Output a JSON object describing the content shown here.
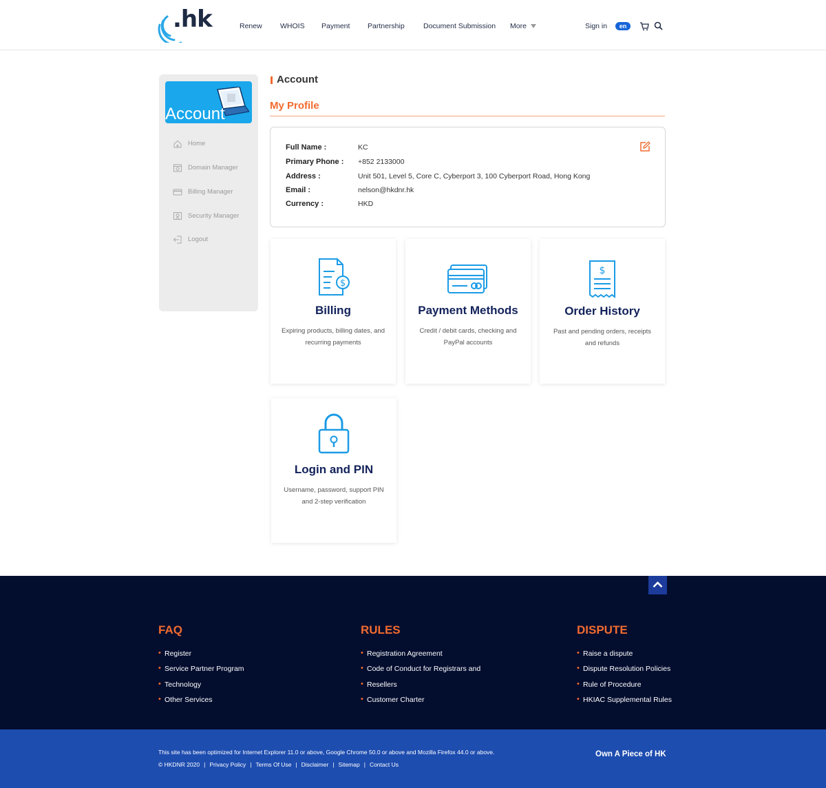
{
  "header": {
    "logo_text": ".hk",
    "nav": [
      "Renew",
      "WHOIS",
      "Payment",
      "Partnership",
      "Document Submission",
      "More"
    ],
    "signin": "Sign in",
    "lang": "en"
  },
  "sidebar": {
    "banner_text": "Account",
    "items": [
      {
        "label": "Home",
        "icon": "home-icon"
      },
      {
        "label": "Domain Manager",
        "icon": "domain-icon"
      },
      {
        "label": "Billing Manager",
        "icon": "billing-card-icon"
      },
      {
        "label": "Security Manager",
        "icon": "security-icon"
      },
      {
        "label": "Logout",
        "icon": "logout-icon"
      }
    ]
  },
  "main": {
    "section_title": "Account",
    "profile_title": "My Profile",
    "profile": [
      {
        "label": "Full Name :",
        "value": "KC"
      },
      {
        "label": "Primary Phone :",
        "value": "+852 2133000"
      },
      {
        "label": "Address :",
        "value": "Unit 501, Level 5, Core C, Cyberport 3, 100 Cyberport Road, Hong Kong"
      },
      {
        "label": "Email :",
        "value": "nelson@hkdnr.hk"
      },
      {
        "label": "Currency :",
        "value": "HKD"
      }
    ],
    "cards": [
      {
        "title": "Billing",
        "desc": "Expiring products, billing dates, and recurring payments",
        "icon": "invoice-dollar-icon"
      },
      {
        "title": "Payment Methods",
        "desc": "Credit / debit cards, checking and PayPal accounts",
        "icon": "credit-card-icon"
      },
      {
        "title": "Order History",
        "desc": "Past and pending orders, receipts and refunds",
        "icon": "receipt-icon"
      },
      {
        "title": "Login and PIN",
        "desc": "Username, password, support PIN and 2-step verification",
        "icon": "padlock-icon"
      }
    ]
  },
  "footer": {
    "columns": [
      {
        "title": "FAQ",
        "links": [
          "Register",
          "Service Partner Program",
          "Technology",
          "Other Services"
        ]
      },
      {
        "title": "RULES",
        "links": [
          "Registration Agreement",
          "Code of Conduct for Registrars and",
          "Resellers",
          "Customer Charter"
        ]
      },
      {
        "title": "DISPUTE",
        "links": [
          "Raise a dispute",
          "Dispute Resolution Policies",
          "Rule of Procedure",
          "HKIAC Supplemental Rules"
        ]
      }
    ],
    "optimized": "This site has been optimized for Internet Explorer 11.0 or above, Google Chrome 50.0 or above and Mozilla Firefox 44.0 or above.",
    "copyright": "© HKDNR 2020",
    "bottom_links": [
      "Privacy Policy",
      "Terms Of Use",
      "Disclaimer",
      "Sitemap",
      "Contact Us"
    ],
    "slogan": "Own A Piece of HK"
  },
  "colors": {
    "accent": "#f26b2f",
    "brand_blue": "#1565d8",
    "footer_dark": "#030d2e",
    "footer_bar": "#1e4db0",
    "icon_blue": "#1a9be6",
    "card_title": "#12225a"
  }
}
